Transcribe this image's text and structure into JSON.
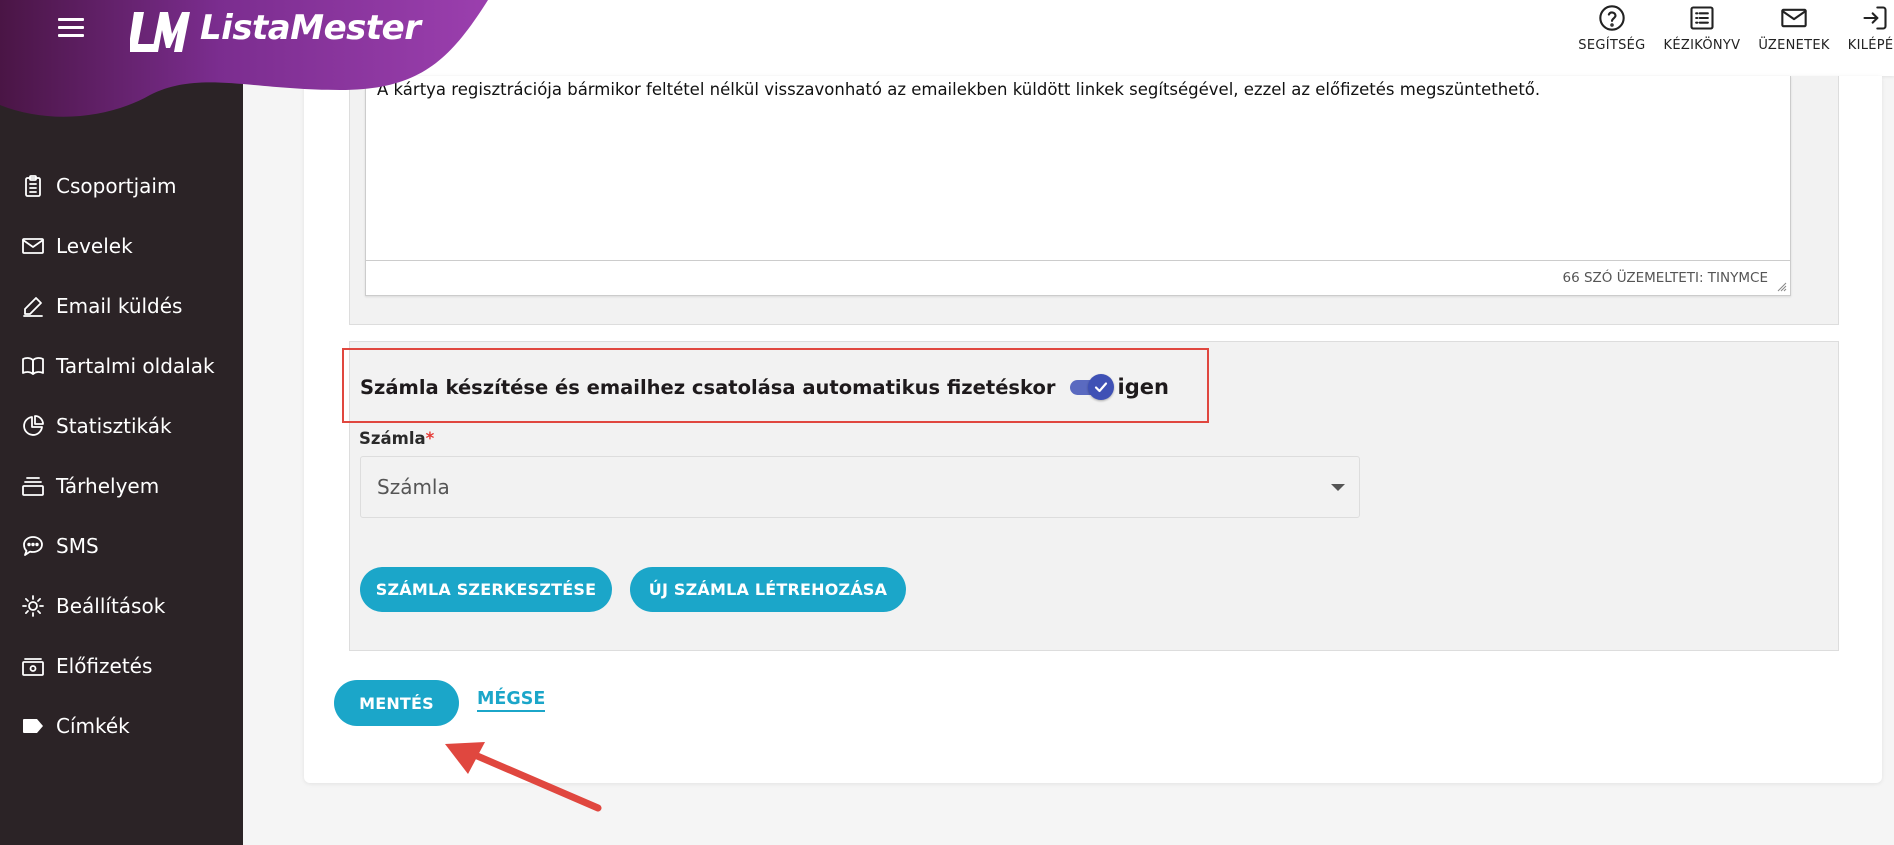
{
  "app": {
    "brand": "ListaMester",
    "brand_colors": {
      "sidebar": "#2b2326",
      "logo_band": "#7b2d8f",
      "accent": "#1ba6c9",
      "toggle": "#3f51b5",
      "annotation": "#e0473f"
    }
  },
  "sidebar": {
    "items": [
      {
        "label": "Csoportjaim",
        "icon": "clipboard-icon"
      },
      {
        "label": "Levelek",
        "icon": "envelope-icon"
      },
      {
        "label": "Email küldés",
        "icon": "pen-icon"
      },
      {
        "label": "Tartalmi oldalak",
        "icon": "book-icon"
      },
      {
        "label": "Statisztikák",
        "icon": "pie-chart-icon"
      },
      {
        "label": "Tárhelyem",
        "icon": "storage-icon"
      },
      {
        "label": "SMS",
        "icon": "chat-bubble-icon"
      },
      {
        "label": "Beállítások",
        "icon": "gear-icon"
      },
      {
        "label": "Előfizetés",
        "icon": "subscription-icon"
      },
      {
        "label": "Címkék",
        "icon": "tag-icon"
      }
    ]
  },
  "topbar": {
    "help": "SEGÍTSÉG",
    "manual": "KÉZIKÖNYV",
    "messages": "ÜZENETEK",
    "logout": "KILÉPÉS"
  },
  "editor": {
    "content": "A kártya regisztrációja bármikor feltétel nélkül visszavonható az emailekben küldött linkek segítségével, ezzel az előfizetés megszüntethető.",
    "status": "66 SZÓ ÜZEMELTETI: TINYMCE"
  },
  "invoice": {
    "toggle_label": "Számla készítése és emailhez csatolása automatikus fizetéskor",
    "toggle_value": "igen",
    "toggle_checked": true,
    "field_label": "Számla",
    "required_mark": "*",
    "select_value": "Számla",
    "edit_button": "SZÁMLA SZERKESZTÉSE",
    "new_button": "ÚJ SZÁMLA LÉTREHOZÁSA"
  },
  "form": {
    "save_button": "MENTÉS",
    "cancel_link": "MÉGSE"
  }
}
